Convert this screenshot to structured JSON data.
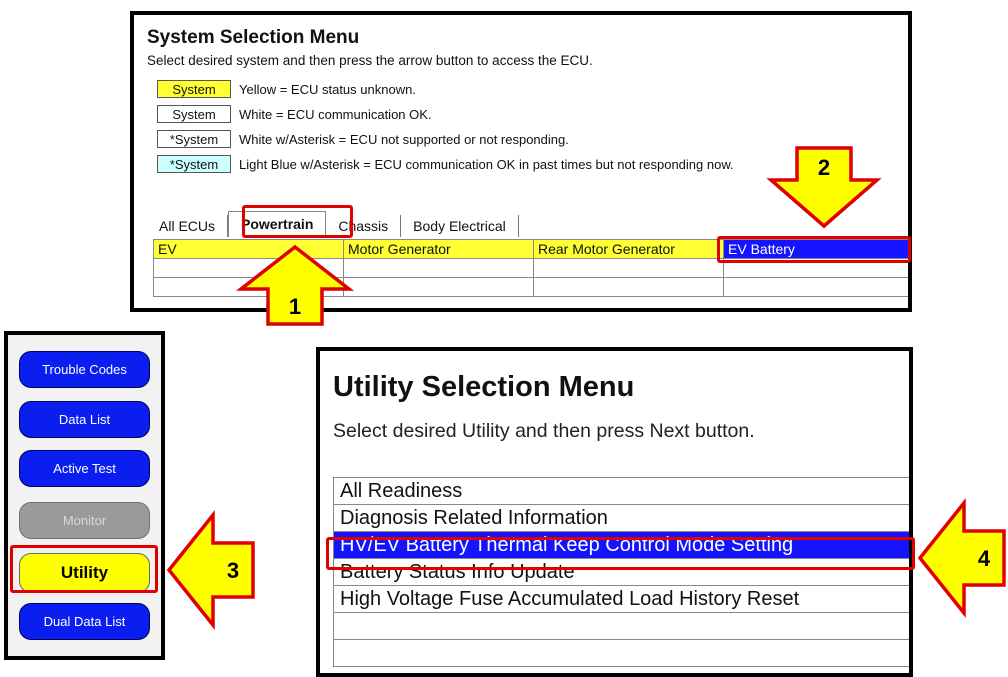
{
  "system_menu": {
    "title": "System Selection Menu",
    "instruction": "Select desired system and then press the arrow button to access the ECU.",
    "legend": [
      {
        "swatch": "System",
        "color": "#ffff33",
        "desc": "Yellow = ECU status unknown."
      },
      {
        "swatch": "System",
        "color": "#ffffff",
        "desc": "White = ECU communication OK."
      },
      {
        "swatch": "*System",
        "color": "#ffffff",
        "desc": "White w/Asterisk = ECU not supported or not responding."
      },
      {
        "swatch": "*System",
        "color": "#ccffff",
        "desc": "Light Blue w/Asterisk = ECU communication OK in past times but not responding now."
      }
    ],
    "tabs": [
      "All ECUs",
      "Powertrain",
      "Chassis",
      "Body Electrical"
    ],
    "active_tab": "Powertrain",
    "ecus": [
      "EV",
      "Motor Generator",
      "Rear Motor Generator",
      "EV Battery"
    ]
  },
  "side_panel": {
    "buttons": [
      "Trouble Codes",
      "Data List",
      "Active Test",
      "Monitor",
      "Utility",
      "Dual Data List"
    ]
  },
  "utility_menu": {
    "title": "Utility Selection Menu",
    "instruction": "Select desired Utility and then press Next button.",
    "items": [
      "All Readiness",
      "Diagnosis Related Information",
      "HV/EV Battery Thermal Keep Control Mode Setting",
      "Battery Status Info Update",
      "High Voltage Fuse Accumulated Load History Reset"
    ],
    "selected_item": "HV/EV Battery Thermal Keep Control Mode Setting"
  },
  "annotations": {
    "step1": "1",
    "step2": "2",
    "step3": "3",
    "step4": "4",
    "highlight_color": "#e00000",
    "arrow_color": "#ffff00"
  }
}
